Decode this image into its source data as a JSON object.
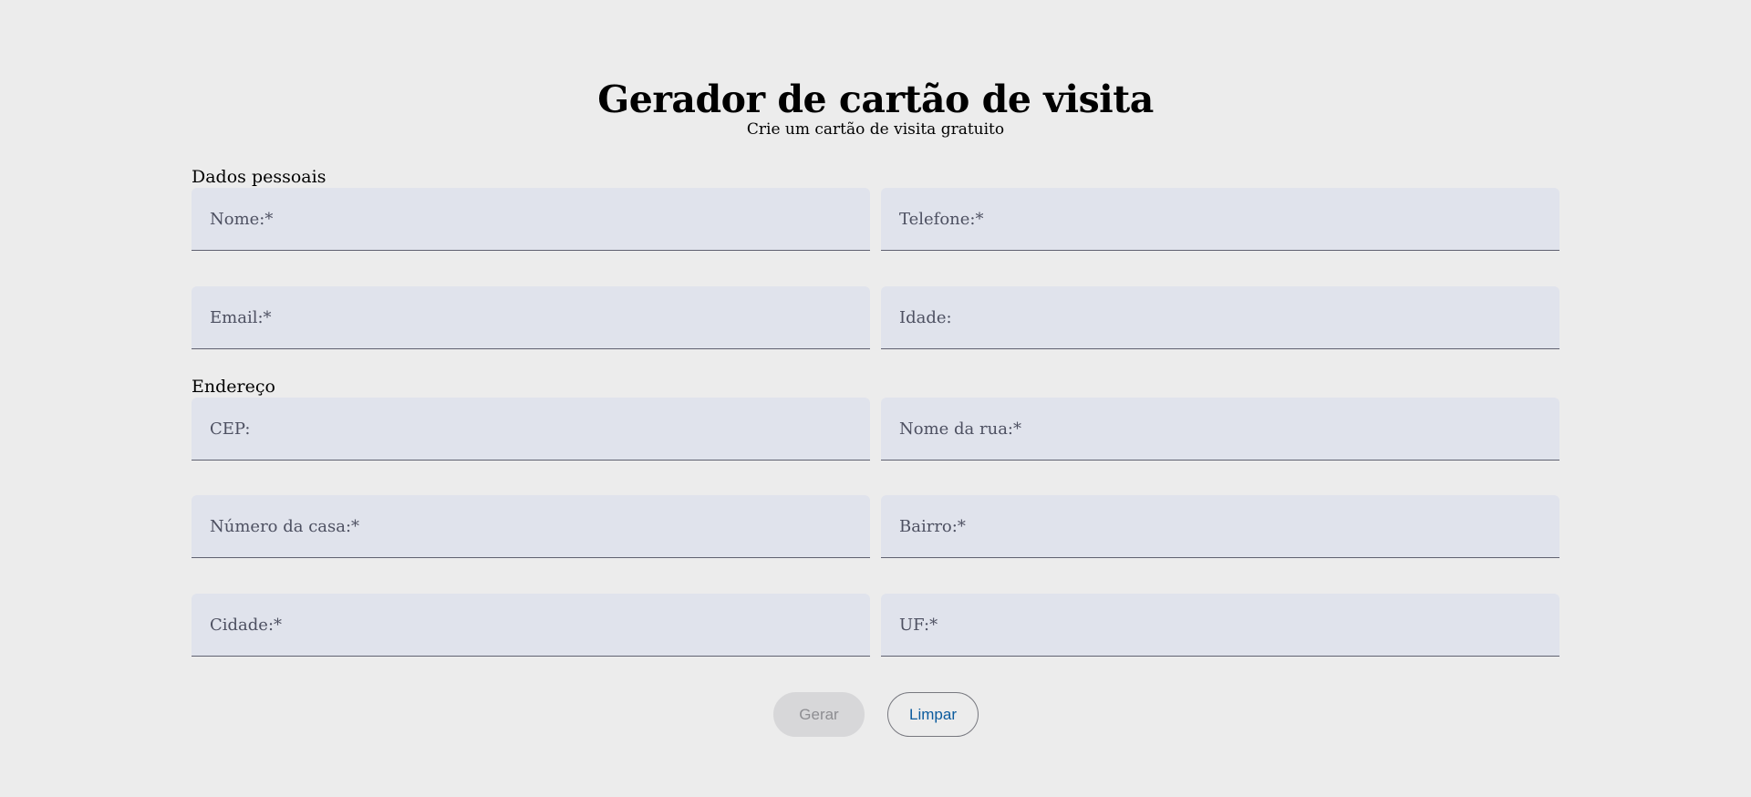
{
  "header": {
    "title": "Gerador de cartão de visita",
    "subtitle": "Crie um cartão de visita gratuito"
  },
  "personal": {
    "section_label": "Dados pessoais",
    "name_label": "Nome:*",
    "phone_label": "Telefone:*",
    "email_label": "Email:*",
    "age_label": "Idade:"
  },
  "address": {
    "section_label": "Endereço",
    "cep_label": "CEP:",
    "street_label": "Nome da rua:*",
    "house_number_label": "Número da casa:*",
    "neighborhood_label": "Bairro:*",
    "city_label": "Cidade:*",
    "state_label": "UF:*"
  },
  "actions": {
    "generate_label": "Gerar",
    "clear_label": "Limpar"
  },
  "colors": {
    "background": "#ececec",
    "field_background": "#e0e3ec",
    "field_label": "#4d5061",
    "link_blue": "#0b5b9e",
    "disabled_button": "#d7d7d9"
  }
}
